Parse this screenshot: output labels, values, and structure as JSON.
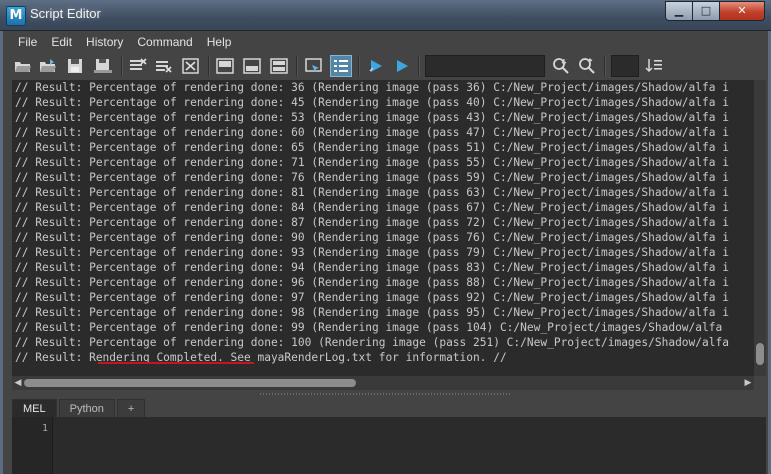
{
  "window": {
    "app_icon_letter": "M",
    "title": "Script Editor",
    "minimize": "▁",
    "maximize": "□",
    "close": "✕"
  },
  "menu": [
    "File",
    "Edit",
    "History",
    "Command",
    "Help"
  ],
  "output_lines": [
    "// Result: Percentage of rendering done: 36 (Rendering image (pass 36) C:/New_Project/images/Shadow/alfa i",
    "// Result: Percentage of rendering done: 45 (Rendering image (pass 40) C:/New_Project/images/Shadow/alfa i",
    "// Result: Percentage of rendering done: 53 (Rendering image (pass 43) C:/New_Project/images/Shadow/alfa i",
    "// Result: Percentage of rendering done: 60 (Rendering image (pass 47) C:/New_Project/images/Shadow/alfa i",
    "// Result: Percentage of rendering done: 65 (Rendering image (pass 51) C:/New_Project/images/Shadow/alfa i",
    "// Result: Percentage of rendering done: 71 (Rendering image (pass 55) C:/New_Project/images/Shadow/alfa i",
    "// Result: Percentage of rendering done: 76 (Rendering image (pass 59) C:/New_Project/images/Shadow/alfa i",
    "// Result: Percentage of rendering done: 81 (Rendering image (pass 63) C:/New_Project/images/Shadow/alfa i",
    "// Result: Percentage of rendering done: 84 (Rendering image (pass 67) C:/New_Project/images/Shadow/alfa i",
    "// Result: Percentage of rendering done: 87 (Rendering image (pass 72) C:/New_Project/images/Shadow/alfa i",
    "// Result: Percentage of rendering done: 90 (Rendering image (pass 76) C:/New_Project/images/Shadow/alfa i",
    "// Result: Percentage of rendering done: 93 (Rendering image (pass 79) C:/New_Project/images/Shadow/alfa i",
    "// Result: Percentage of rendering done: 94 (Rendering image (pass 83) C:/New_Project/images/Shadow/alfa i",
    "// Result: Percentage of rendering done: 96 (Rendering image (pass 88) C:/New_Project/images/Shadow/alfa i",
    "// Result: Percentage of rendering done: 97 (Rendering image (pass 92) C:/New_Project/images/Shadow/alfa i",
    "// Result: Percentage of rendering done: 98 (Rendering image (pass 95) C:/New_Project/images/Shadow/alfa i",
    "// Result: Percentage of rendering done: 99 (Rendering image (pass 104) C:/New_Project/images/Shadow/alfa",
    "// Result: Percentage of rendering done: 100 (Rendering image (pass 251) C:/New_Project/images/Shadow/alfa",
    "// Result: Rendering Completed. See mayaRenderLog.txt for information. //"
  ],
  "tabs": [
    "MEL",
    "Python",
    "+"
  ],
  "input": {
    "line_number": "1"
  },
  "colors": {
    "highlight_underline": "#c41818",
    "active_toolbar_button": "#5285a6",
    "play_icon": "#3fa7e0"
  }
}
